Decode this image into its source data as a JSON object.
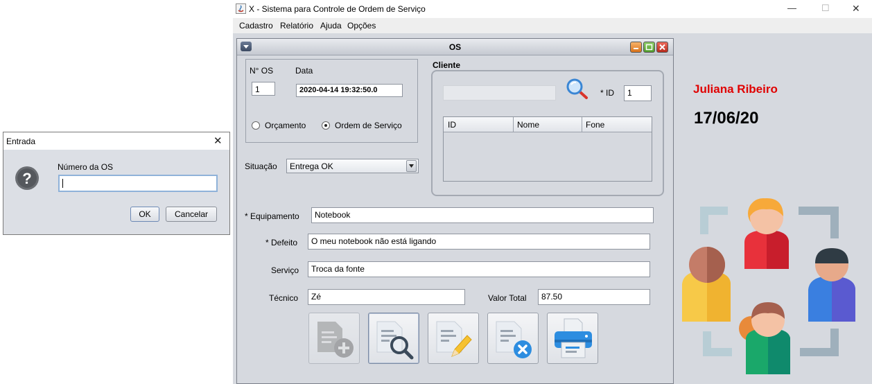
{
  "window": {
    "title": "X - Sistema para Controle de Ordem de Serviço",
    "controls": {
      "minimize": "—",
      "maximize": "☐",
      "close": "✕"
    }
  },
  "menubar": {
    "items": [
      "Cadastro",
      "Relatório",
      "Ajuda",
      "Opções"
    ]
  },
  "os_frame": {
    "title": "OS",
    "os_number_label": "N° OS",
    "os_number_value": "1",
    "date_label": "Data",
    "date_value": "2020-04-14 19:32:50.0",
    "type_options": [
      {
        "label": "Orçamento",
        "selected": false
      },
      {
        "label": "Ordem de Serviço",
        "selected": true
      }
    ],
    "situacao_label": "Situação",
    "situacao_value": "Entrega OK",
    "cliente": {
      "title": "Cliente",
      "search_value": "",
      "id_label": "* ID",
      "id_value": "1",
      "table_headers": [
        "ID",
        "Nome",
        "Fone"
      ]
    },
    "equipamento_label": "* Equipamento",
    "equipamento_value": "Notebook",
    "defeito_label": "* Defeito",
    "defeito_value": "O meu notebook não está ligando",
    "servico_label": "Serviço",
    "servico_value": "Troca da fonte",
    "tecnico_label": "Técnico",
    "tecnico_value": "Zé",
    "valor_label": "Valor Total",
    "valor_value": "87.50",
    "action_icons": [
      "add-document-icon",
      "search-document-icon",
      "edit-document-icon",
      "delete-document-icon",
      "printer-icon"
    ]
  },
  "side_panel": {
    "user_name": "Juliana Ribeiro",
    "date": "17/06/20",
    "user_color": "#e00000"
  },
  "dialog": {
    "title": "Entrada",
    "close": "✕",
    "prompt": "Número da OS",
    "input_value": "",
    "ok_label": "OK",
    "cancel_label": "Cancelar"
  }
}
